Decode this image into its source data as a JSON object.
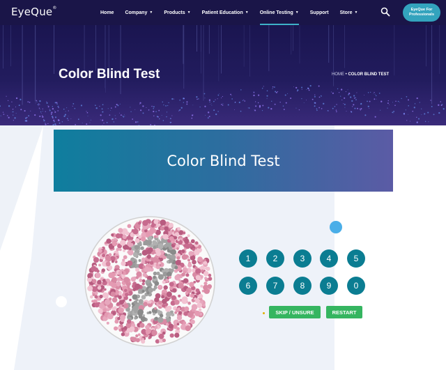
{
  "nav": {
    "logo": "EyeQue",
    "logo_tm": "®",
    "items": [
      {
        "label": "Home",
        "has_caret": false
      },
      {
        "label": "Company",
        "has_caret": true
      },
      {
        "label": "Products",
        "has_caret": true
      },
      {
        "label": "Patient Education",
        "has_caret": true
      },
      {
        "label": "Online Testing",
        "has_caret": true,
        "active": true
      },
      {
        "label": "Support",
        "has_caret": false
      },
      {
        "label": "Store",
        "has_caret": true
      }
    ],
    "caret": "▼",
    "search_icon": "search-icon",
    "pro_button": "EyeQue For Professionals"
  },
  "hero": {
    "title": "Color Blind Test",
    "breadcrumb_home": "HOME",
    "breadcrumb_sep": "•",
    "breadcrumb_current": "COLOR BLIND TEST"
  },
  "test": {
    "banner_title": "Color Blind Test",
    "plate_icon": "ishihara-plate",
    "numbers": [
      "1",
      "2",
      "3",
      "4",
      "5",
      "6",
      "7",
      "8",
      "9",
      "0"
    ],
    "skip_label": "SKIP / UNSURE",
    "restart_label": "RESTART"
  },
  "colors": {
    "nav_bg": "#1a1548",
    "accent": "#33a3bd",
    "number_button": "#0b7d92",
    "action_button": "#35b560"
  }
}
